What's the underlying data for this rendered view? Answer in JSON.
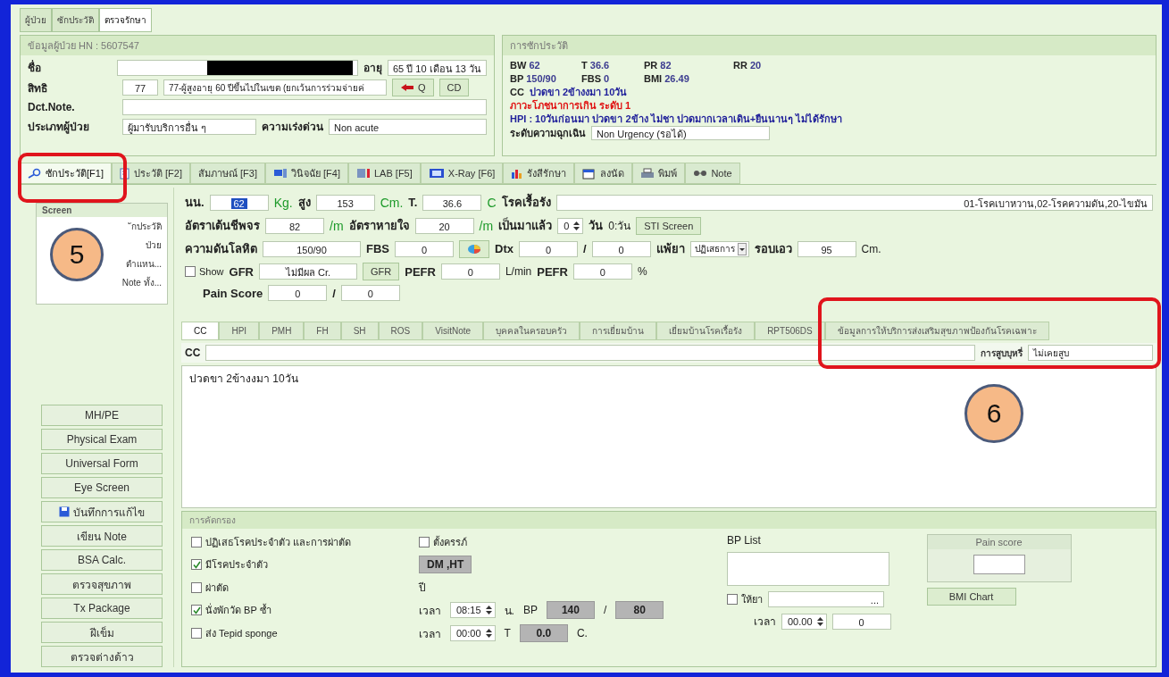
{
  "top_tabs": [
    {
      "label": "ผู้ป่วย",
      "selected": false
    },
    {
      "label": "ซักประวัติ",
      "selected": false
    },
    {
      "label": "ตรวจรักษา",
      "selected": true
    }
  ],
  "patient": {
    "title": "ข้อมูลผู้ป่วย HN : 5607547",
    "name_label": "ชื่อ",
    "age_label": "อายุ",
    "age": "65 ปี 10 เดือน 13 วัน",
    "right_label": "สิทธิ",
    "right_code": "77",
    "right_name": "77-ผู้สูงอายุ 60 ปีขึ้นไปในเขต (ยกเว้นการร่วมจ่ายค่",
    "q_button": "Q",
    "cd_button": "CD",
    "note_label": "Dct.Note.",
    "type_label": "ประเภทผู้ป่วย",
    "type": "ผู้มารับบริการอื่น ๆ",
    "urgency_label": "ความเร่งด่วน",
    "urgency": "Non acute"
  },
  "history": {
    "title": "การซักประวัติ",
    "vitals": [
      [
        {
          "label": "BW",
          "value": "62"
        },
        {
          "label": "T",
          "value": "36.6"
        },
        {
          "label": "PR",
          "value": "82"
        },
        {
          "label": "RR",
          "value": "20"
        }
      ],
      [
        {
          "label": "BP",
          "value": "150/90"
        },
        {
          "label": "FBS",
          "value": "0"
        },
        {
          "label": "BMI",
          "value": "26.49"
        }
      ]
    ],
    "cc_label": "CC",
    "cc": "ปวดขา 2ข้างงมา 10วัน",
    "alert": "ภาวะโภชนาการเกิน ระดับ 1",
    "hpi": "HPI : 10วันก่อนมา ปวดขา 2ข้าง ไม่ชา ปวดมากเวลาเดิน+ยืนนานๆ ไม่ได้รักษา",
    "emergency_label": "ระดับความฉุกเฉิน",
    "emergency": "Non Urgency (รอได้)"
  },
  "main_tabs": [
    {
      "label": "ซักประวัติ[F1]",
      "selected": true
    },
    {
      "label": "ประวัติ [F2]",
      "selected": false
    },
    {
      "label": "สัมภาษณ์ [F3]",
      "selected": false
    },
    {
      "label": "วินิจฉัย [F4]",
      "selected": false
    },
    {
      "label": "LAB [F5]",
      "selected": false
    },
    {
      "label": "X-Ray [F6]",
      "selected": false
    },
    {
      "label": "รังสีรักษา",
      "selected": false
    },
    {
      "label": "ลงนัด",
      "selected": false
    },
    {
      "label": "พิมพ์",
      "selected": false
    },
    {
      "label": "Note",
      "selected": false
    }
  ],
  "sidebar": {
    "panel_title": "Screen",
    "panel_items": [
      "ักประวัติ",
      "ป่วย",
      "ตำแหน...",
      "Note ทั้ง..."
    ],
    "buttons": [
      {
        "label": "MH/PE",
        "kind": "plain"
      },
      {
        "label": "Physical Exam",
        "kind": "plain"
      },
      {
        "label": "Universal Form",
        "kind": "plain"
      },
      {
        "label": "Eye Screen",
        "kind": "plain"
      },
      {
        "label": "บันทึกการแก้ไข",
        "kind": "save"
      },
      {
        "label": "เขียน Note",
        "kind": "plain"
      },
      {
        "label": "BSA Calc.",
        "kind": "plain"
      },
      {
        "label": "ตรวจสุขภาพ",
        "kind": "plain"
      },
      {
        "label": "Tx Package",
        "kind": "plain"
      },
      {
        "label": "ฝีเข็ม",
        "kind": "plain"
      },
      {
        "label": "ตรวจต่างด้าว",
        "kind": "plain"
      }
    ]
  },
  "vitals_form": [
    [
      {
        "kind": "label",
        "text": "นน."
      },
      {
        "kind": "field",
        "value": "62",
        "highlighted": true
      },
      {
        "kind": "unit",
        "text": "Kg."
      },
      {
        "kind": "label",
        "text": "สูง"
      },
      {
        "kind": "field",
        "value": "153",
        "highlighted": false
      },
      {
        "kind": "unit",
        "text": "Cm."
      },
      {
        "kind": "label",
        "text": "T."
      },
      {
        "kind": "field",
        "value": "36.6",
        "highlighted": false
      },
      {
        "kind": "unit",
        "text": "C"
      },
      {
        "kind": "label",
        "text": "โรคเรื้อรัง"
      },
      {
        "kind": "fillfield",
        "value": "01-โรคเบาหวาน,02-โรคความดัน,20-ไขมัน"
      }
    ],
    [
      {
        "kind": "label",
        "text": "อัตราเต้นชีพจร"
      },
      {
        "kind": "field",
        "value": "82",
        "highlighted": false
      },
      {
        "kind": "unit",
        "text": "/m"
      },
      {
        "kind": "label",
        "text": "อัตราหายใจ"
      },
      {
        "kind": "field",
        "value": "20",
        "highlighted": false
      },
      {
        "kind": "unit",
        "text": "/m"
      },
      {
        "kind": "label",
        "text": "เป็นมาแล้ว"
      },
      {
        "kind": "spin",
        "value": "0"
      },
      {
        "kind": "label",
        "text": "วัน"
      },
      {
        "kind": "plain",
        "text": "0:วัน"
      },
      {
        "kind": "button",
        "text": "STI Screen"
      }
    ],
    [
      {
        "kind": "label",
        "text": "ความดันโลหิต"
      },
      {
        "kind": "longfield",
        "value": "150/90"
      },
      {
        "kind": "label",
        "text": "FBS"
      },
      {
        "kind": "field",
        "value": "0",
        "highlighted": false
      },
      {
        "kind": "iconbutton"
      },
      {
        "kind": "label",
        "text": "Dtx"
      },
      {
        "kind": "field",
        "value": "0",
        "highlighted": false
      },
      {
        "kind": "label",
        "text": "/"
      },
      {
        "kind": "field",
        "value": "0",
        "highlighted": false
      },
      {
        "kind": "label",
        "text": "แพ้ยา"
      },
      {
        "kind": "select",
        "value": "ปฏิเสธการ"
      },
      {
        "kind": "label",
        "text": "รอบเอว"
      },
      {
        "kind": "field",
        "value": "95",
        "highlighted": false
      },
      {
        "kind": "plain",
        "text": "Cm."
      }
    ],
    [
      {
        "kind": "checkbox",
        "text": "Show",
        "checked": false
      },
      {
        "kind": "label",
        "text": "GFR"
      },
      {
        "kind": "longfield",
        "value": "ไม่มีผล Cr."
      },
      {
        "kind": "button",
        "text": "GFR"
      },
      {
        "kind": "label",
        "text": "PEFR"
      },
      {
        "kind": "field",
        "value": "0",
        "highlighted": false
      },
      {
        "kind": "plain",
        "text": "L/min"
      },
      {
        "kind": "label",
        "text": "PEFR"
      },
      {
        "kind": "field",
        "value": "0",
        "highlighted": false
      },
      {
        "kind": "plain",
        "text": "%"
      }
    ],
    [
      {
        "kind": "label",
        "text": "Pain Score"
      },
      {
        "kind": "field",
        "value": "0",
        "highlighted": false
      },
      {
        "kind": "label",
        "text": "/"
      },
      {
        "kind": "field",
        "value": "0",
        "highlighted": false
      }
    ]
  ],
  "sub_tabs": [
    {
      "label": "CC",
      "selected": true
    },
    {
      "label": "HPI",
      "selected": false
    },
    {
      "label": "PMH",
      "selected": false
    },
    {
      "label": "FH",
      "selected": false
    },
    {
      "label": "SH",
      "selected": false
    },
    {
      "label": "ROS",
      "selected": false
    },
    {
      "label": "VisitNote",
      "selected": false
    },
    {
      "label": "บุคคลในครอบครัว",
      "selected": false
    },
    {
      "label": "การเยี่ยมบ้าน",
      "selected": false
    },
    {
      "label": "เยี่ยมบ้านโรคเรื้อรัง",
      "selected": false
    },
    {
      "label": "RPT506DS",
      "selected": false
    },
    {
      "label": "ข้อมูลการให้บริการส่งเสริมสุขภาพป้องกันโรคเฉพาะ",
      "selected": false
    }
  ],
  "cc": {
    "label": "CC",
    "smoking_label": "การสูบบุหรี่",
    "smoking": "ไม่เคยสูบ",
    "text": "ปวดขา 2ข้างงมา 10วัน"
  },
  "screening": {
    "title": "การคัดกรอง",
    "rows": [
      [
        {
          "kind": "checkbox",
          "text": "ปฏิเสธโรคประจำตัว และการผ่าตัด",
          "checked": false
        },
        {
          "kind": "checkbox",
          "text": "ตั้งครรภ์",
          "checked": false
        }
      ],
      [
        {
          "kind": "checkbox",
          "text": "มีโรคประจำตัว",
          "checked": true
        },
        {
          "kind": "grayfield",
          "value": "DM ,HT"
        }
      ],
      [
        {
          "kind": "checkbox",
          "text": "ผ่าตัด",
          "checked": false
        },
        {
          "kind": "plain",
          "text": "ปี"
        }
      ],
      [
        {
          "kind": "checkbox",
          "text": "นั่งพักวัด BP ซ้ำ",
          "checked": true
        },
        {
          "kind": "plain",
          "text": "เวลา"
        },
        {
          "kind": "spin",
          "value": "08:15"
        },
        {
          "kind": "plain",
          "text": "น."
        },
        {
          "kind": "plain",
          "text": "BP"
        },
        {
          "kind": "grayfield",
          "value": "140"
        },
        {
          "kind": "plain",
          "text": "/"
        },
        {
          "kind": "grayfield",
          "value": "80"
        }
      ],
      [
        {
          "kind": "checkbox",
          "text": "ส่ง Tepid sponge",
          "checked": false
        },
        {
          "kind": "plain",
          "text": "เวลา"
        },
        {
          "kind": "spin",
          "value": "00:00"
        },
        {
          "kind": "plain",
          "text": "T"
        },
        {
          "kind": "grayfield",
          "value": "0.0"
        },
        {
          "kind": "plain",
          "text": "C."
        }
      ]
    ],
    "bp_list_label": "BP List",
    "drug": [
      {
        "kind": "checkbox",
        "text": "ให้ยา",
        "checked": false
      },
      {
        "kind": "browse",
        "value": "..."
      }
    ],
    "drug_time": [
      {
        "kind": "plain",
        "text": "เวลา"
      },
      {
        "kind": "spin",
        "value": "00.00"
      },
      {
        "kind": "field",
        "value": "0",
        "highlighted": false
      }
    ],
    "pain_title": "Pain score",
    "bmi_button": "BMI Chart"
  },
  "annotations": [
    {
      "label": "5"
    },
    {
      "label": "6"
    }
  ]
}
